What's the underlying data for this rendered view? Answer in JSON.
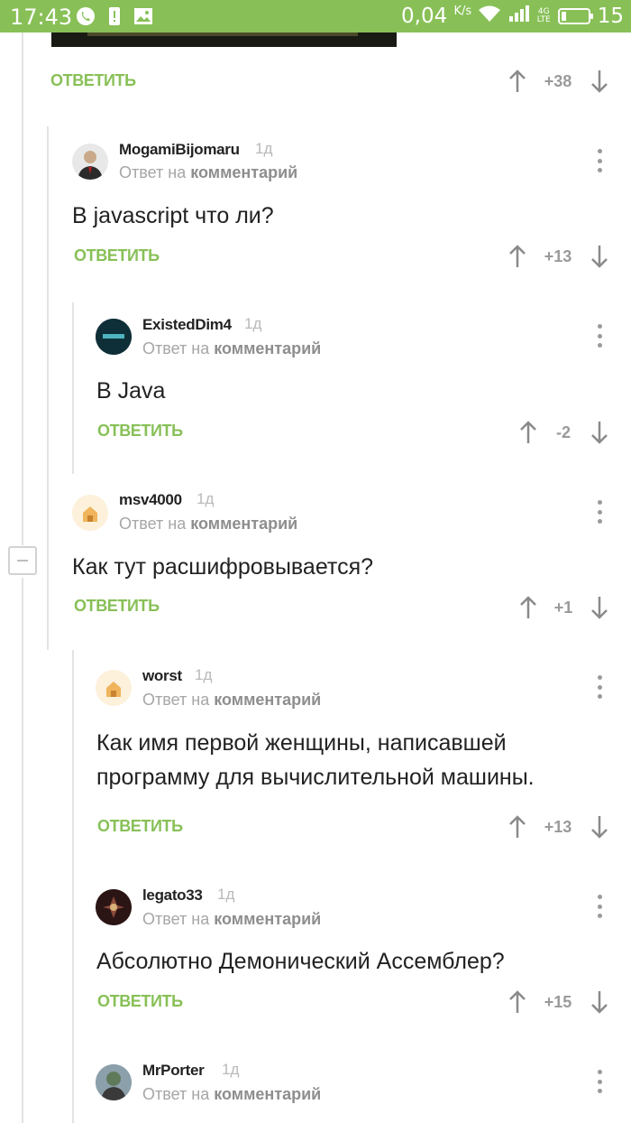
{
  "status_bar": {
    "time": "17:43",
    "net_speed": "0,04",
    "net_unit": "K/s",
    "network_type_top": "4G",
    "network_type_bottom": "LTE",
    "battery": "15",
    "icons": [
      "viber-icon",
      "notification-icon",
      "gallery-icon",
      "wifi-icon",
      "signal-icon",
      "battery-icon"
    ]
  },
  "top_comment": {
    "reply_label": "ОТВЕТИТЬ",
    "score": "+38"
  },
  "comments": [
    {
      "username": "MogamiBijomaru",
      "age": "1д",
      "reply_prefix": "Ответ на",
      "reply_target": "комментарий",
      "text": [
        "В javascript что ли?"
      ],
      "reply_label": "ОТВЕТИТЬ",
      "score": "+13"
    },
    {
      "username": "ExistedDim4",
      "age": "1д",
      "reply_prefix": "Ответ на",
      "reply_target": "комментарий",
      "text": [
        "В Java"
      ],
      "reply_label": "ОТВЕТИТЬ",
      "score": "-2"
    },
    {
      "username": "msv4000",
      "age": "1д",
      "reply_prefix": "Ответ на",
      "reply_target": "комментарий",
      "text": [
        "Как тут расшифровывается?"
      ],
      "reply_label": "ОТВЕТИТЬ",
      "score": "+1"
    },
    {
      "username": "worst",
      "age": "1д",
      "reply_prefix": "Ответ на",
      "reply_target": "комментарий",
      "text": [
        "Как имя первой женщины, написавшей",
        "программу для вычислительной машины."
      ],
      "reply_label": "ОТВЕТИТЬ",
      "score": "+13"
    },
    {
      "username": "legato33",
      "age": "1д",
      "reply_prefix": "Ответ на",
      "reply_target": "комментарий",
      "text": [
        "Абсолютно Демонический Ассемблер?"
      ],
      "reply_label": "ОТВЕТИТЬ",
      "score": "+15"
    },
    {
      "username": "MrPorter",
      "age": "1д",
      "reply_prefix": "Ответ на",
      "reply_target": "комментарий",
      "text": [],
      "reply_label": "",
      "score": ""
    }
  ],
  "colors": {
    "accent": "#88c057",
    "status_bar": "#88c057",
    "text": "#222222",
    "muted": "#a6a6a6"
  }
}
